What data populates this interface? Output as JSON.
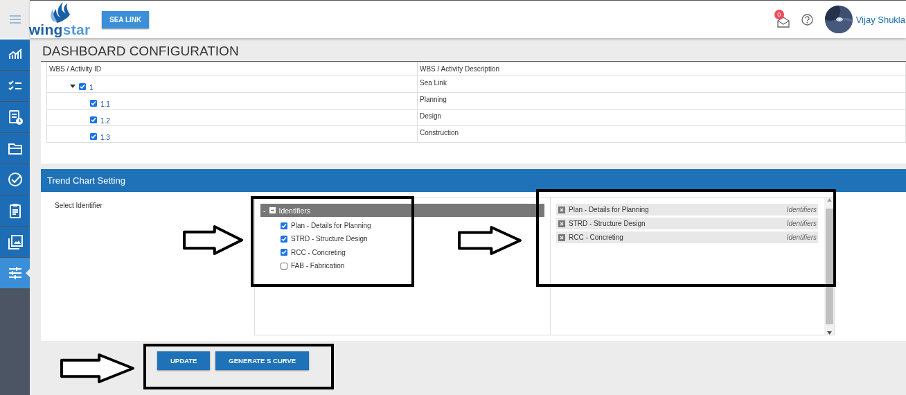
{
  "sidebar": {
    "items": [
      {
        "selected": false
      },
      {
        "selected": false
      },
      {
        "selected": false
      },
      {
        "selected": false
      },
      {
        "selected": false
      },
      {
        "selected": false
      },
      {
        "selected": false
      },
      {
        "selected": true
      }
    ]
  },
  "header": {
    "logo": {
      "text_a": "wing",
      "text_b": "star"
    },
    "project_button": "SEA LINK",
    "mail_badge": "0",
    "user_name": "Vijay Shukla"
  },
  "page_title": "DASHBOARD CONFIGURATION",
  "wbs_table": {
    "columns": [
      "WBS / Activity ID",
      "WBS / Activity Description"
    ],
    "rows": [
      {
        "id": "1",
        "description": "Sea Link",
        "checked": true,
        "expanded": true,
        "children": [
          {
            "id": "1.1",
            "description": "Planning",
            "checked": true
          },
          {
            "id": "1.2",
            "description": "Design",
            "checked": true
          },
          {
            "id": "1.3",
            "description": "Construction",
            "checked": true
          }
        ]
      }
    ]
  },
  "trend_chart_setting": {
    "title": "Trend Chart Setting",
    "field_label": "Select Identifier",
    "tree": {
      "toggle": "-",
      "label": "Identifiers",
      "expanded": true,
      "items": [
        {
          "label": "Plan - Details for Planning",
          "checked": true
        },
        {
          "label": "STRD - Structure Design",
          "checked": true
        },
        {
          "label": "RCC - Concreting",
          "checked": true
        },
        {
          "label": "FAB - Fabrication",
          "checked": false
        }
      ]
    },
    "selected_items": [
      {
        "label": "Plan - Details for Planning",
        "group": "Identifiers"
      },
      {
        "label": "STRD - Structure Design",
        "group": "Identifiers"
      },
      {
        "label": "RCC - Concreting",
        "group": "Identifiers"
      }
    ],
    "buttons": [
      "UPDATE",
      "GENERATE S CURVE"
    ]
  }
}
